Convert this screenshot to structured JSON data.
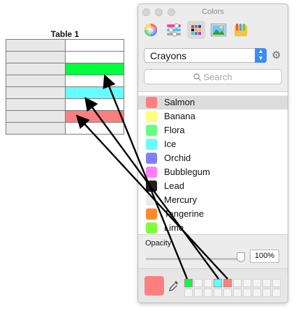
{
  "table": {
    "title": "Table 1",
    "row_fills": [
      "#ffffff",
      "#ffffff",
      "#00ff3c",
      "#ffffff",
      "#66ffff",
      "#ffffff",
      "#fe7f7f",
      "#ffffff"
    ]
  },
  "panel": {
    "title": "Colors",
    "tools": [
      "color-wheel-icon",
      "sliders-icon",
      "palettes-icon",
      "image-palette-icon",
      "pencils-icon"
    ],
    "active_tool": 2,
    "palette_dropdown": {
      "value": "Crayons"
    },
    "search": {
      "placeholder": "Search"
    },
    "colors": [
      {
        "name": "Salmon",
        "hex": "#ff7f7f",
        "selected": true
      },
      {
        "name": "Banana",
        "hex": "#ffff7f"
      },
      {
        "name": "Flora",
        "hex": "#66ff7f"
      },
      {
        "name": "Ice",
        "hex": "#66ffff"
      },
      {
        "name": "Orchid",
        "hex": "#7f7fff"
      },
      {
        "name": "Bubblegum",
        "hex": "#ff7fff"
      },
      {
        "name": "Lead",
        "hex": "#202020"
      },
      {
        "name": "Mercury",
        "hex": "#ebebeb"
      },
      {
        "name": "Tangerine",
        "hex": "#ff8a2e"
      },
      {
        "name": "Lime",
        "hex": "#7fff3c"
      }
    ],
    "opacity": {
      "label": "Opacity",
      "value_text": "100%",
      "value": 1.0
    },
    "current_color": "#fe7f7f",
    "swatch_grid": {
      "cols": 10,
      "rows": 2,
      "filled": [
        {
          "index": 0,
          "hex": "#00ff3c"
        },
        {
          "index": 3,
          "hex": "#66ffff"
        },
        {
          "index": 4,
          "hex": "#fe7f7f"
        }
      ]
    }
  }
}
